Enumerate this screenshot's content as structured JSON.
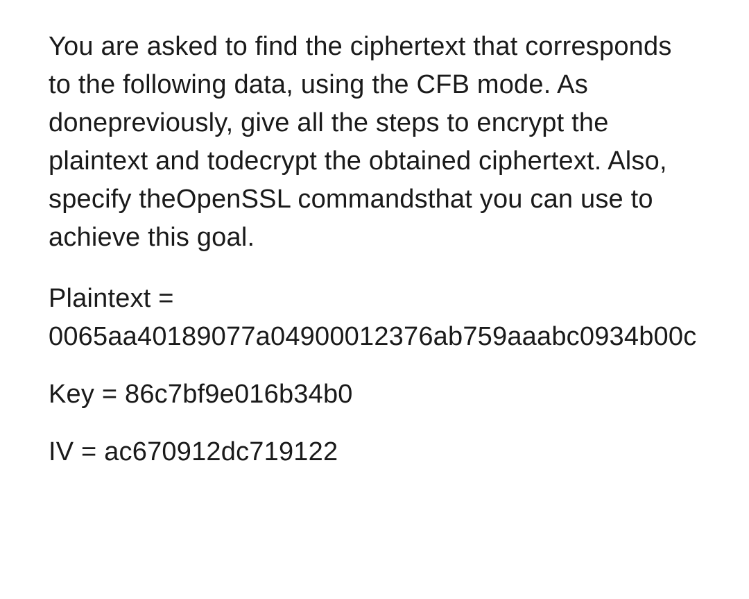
{
  "question": {
    "prompt": "You are asked to find the ciphertext that corresponds to the following data, using the CFB mode. As donepreviously, give all the steps to encrypt the plaintext and todecrypt the obtained ciphertext. Also, specify theOpenSSL commandsthat you can use to achieve this goal.",
    "plaintext_label": "Plaintext = ",
    "plaintext_value": "0065aa40189077a04900012376ab759aaabc0934b00c",
    "key_label": "Key = ",
    "key_value": "86c7bf9e016b34b0",
    "iv_label": "IV = ",
    "iv_value": "ac670912dc719122"
  }
}
